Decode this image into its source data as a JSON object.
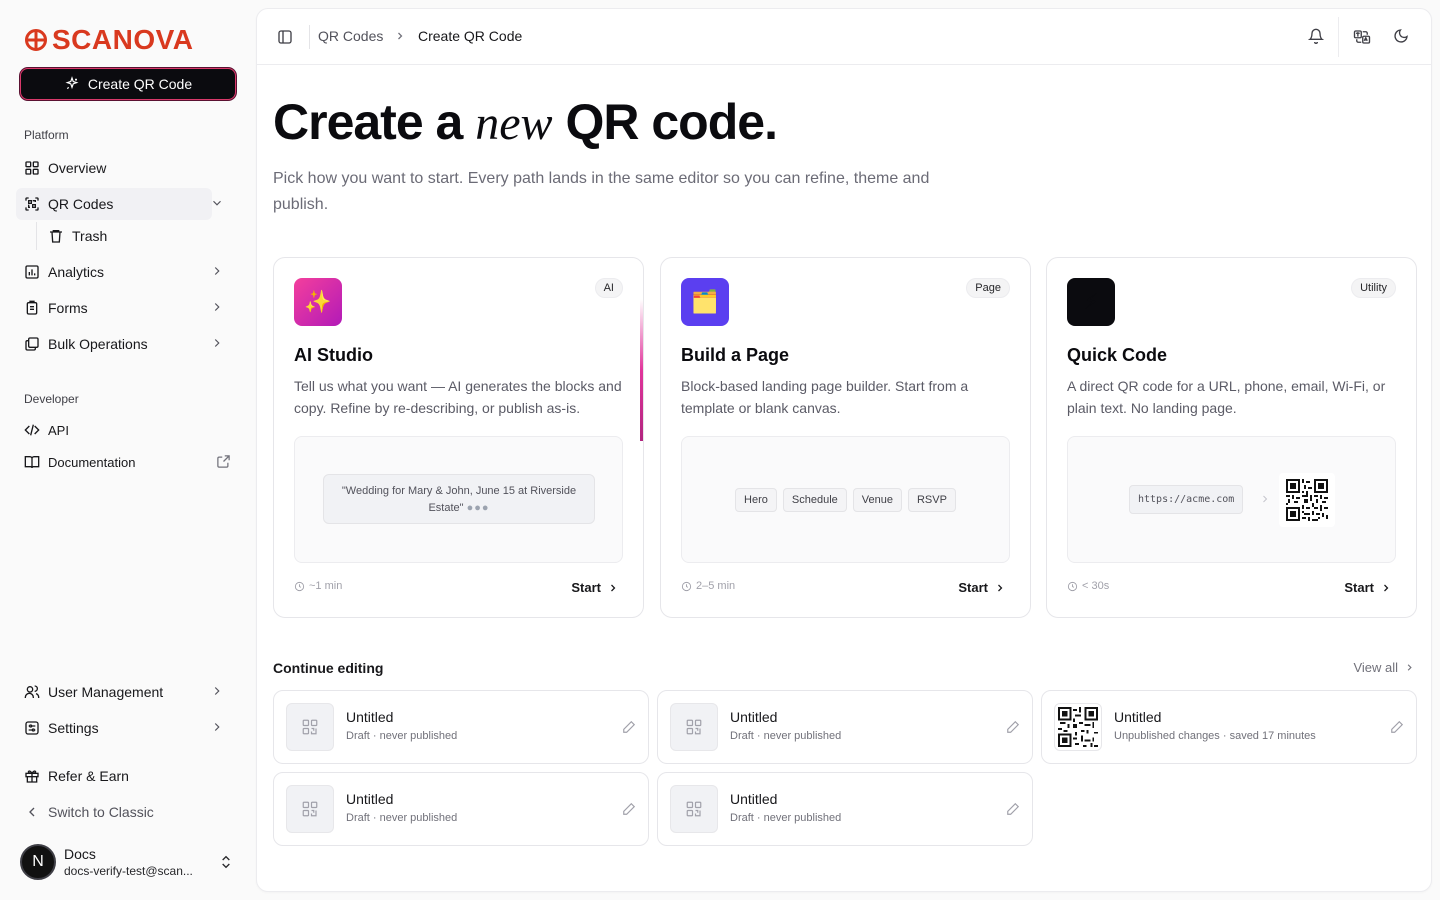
{
  "brand": {
    "name": "SCANOVA",
    "color": "#d9391f"
  },
  "sidebar": {
    "create_label": "Create QR Code",
    "platform_label": "Platform",
    "developer_label": "Developer",
    "items": [
      {
        "label": "Overview",
        "icon": "grid-icon"
      },
      {
        "label": "QR Codes",
        "icon": "qr-scan-icon",
        "active": true
      },
      {
        "label": "Trash",
        "icon": "trash-icon"
      },
      {
        "label": "Analytics",
        "icon": "chart-icon"
      },
      {
        "label": "Forms",
        "icon": "clipboard-icon"
      },
      {
        "label": "Bulk Operations",
        "icon": "layers-icon"
      },
      {
        "label": "API",
        "icon": "code-icon"
      },
      {
        "label": "Documentation",
        "icon": "book-icon"
      },
      {
        "label": "User Management",
        "icon": "users-icon"
      },
      {
        "label": "Settings",
        "icon": "settings-icon"
      },
      {
        "label": "Refer & Earn",
        "icon": "gift-icon"
      },
      {
        "label": "Switch to Classic",
        "icon": "chevron-left-icon"
      }
    ],
    "user": {
      "initial": "N",
      "name": "Docs",
      "email": "docs-verify-test@scan..."
    }
  },
  "header": {
    "breadcrumb": [
      "QR Codes",
      "Create QR Code"
    ]
  },
  "hero": {
    "title_before": "Create a",
    "title_em": "new",
    "title_after": "QR code.",
    "subtitle": "Pick how you want to start. Every path lands in the same editor so you can refine, theme and publish."
  },
  "cards": [
    {
      "title": "AI Studio",
      "badge": "AI",
      "icon": "✨",
      "description": "Tell us what you want — AI generates the blocks and copy. Refine by re-describing, or publish as-is.",
      "preview_prompt": "\"Wedding for Mary & John, June 15 at Riverside Estate\"",
      "time": "~1 min",
      "action": "Start",
      "gradient": [
        "#ec4899",
        "#a21caf"
      ]
    },
    {
      "title": "Build a Page",
      "badge": "Page",
      "icon": "🗂️",
      "description": "Block-based landing page builder. Start from a template or blank canvas.",
      "chips": [
        "Hero",
        "Schedule",
        "Venue",
        "RSVP"
      ],
      "time": "2–5 min",
      "action": "Start",
      "color": "#5b3ff0"
    },
    {
      "title": "Quick Code",
      "badge": "Utility",
      "icon": "⚡",
      "description": "A direct QR code for a URL, phone, email, Wi-Fi, or plain text. No landing page.",
      "preview_url": "https://acme.com",
      "time": "< 30s",
      "action": "Start",
      "color": "#0b0b0f"
    }
  ],
  "continue": {
    "title": "Continue editing",
    "view_all": "View all",
    "drafts": [
      {
        "title": "Untitled",
        "status": "Draft · never published",
        "thumb": "placeholder"
      },
      {
        "title": "Untitled",
        "status": "Draft · never published",
        "thumb": "placeholder"
      },
      {
        "title": "Untitled",
        "status": "Unpublished changes · saved 17 minutes",
        "thumb": "qr"
      },
      {
        "title": "Untitled",
        "status": "Draft · never published",
        "thumb": "placeholder"
      },
      {
        "title": "Untitled",
        "status": "Draft · never published",
        "thumb": "placeholder"
      }
    ]
  }
}
